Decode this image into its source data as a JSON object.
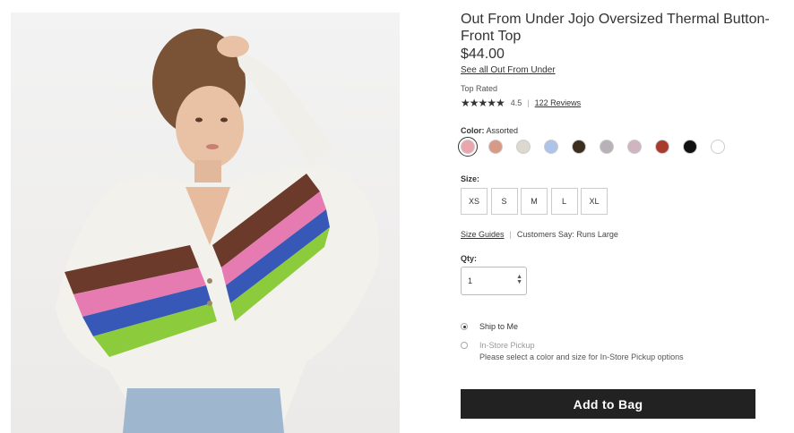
{
  "product": {
    "title": "Out From Under Jojo Oversized Thermal Button-Front Top",
    "price": "$44.00",
    "brand_link": "See all Out From Under",
    "badge": "Top Rated",
    "stars": "★★★★★",
    "rating": "4.5",
    "reviews": "122 Reviews"
  },
  "color": {
    "label": "Color:",
    "selected": "Assorted",
    "swatches": [
      {
        "name": "assorted",
        "color": "#e9a7ad"
      },
      {
        "name": "peach",
        "color": "#d89a86"
      },
      {
        "name": "cream",
        "color": "#dcd8cf"
      },
      {
        "name": "light-blue",
        "color": "#aec3e8"
      },
      {
        "name": "black-stripe",
        "color": "#3c2d1e"
      },
      {
        "name": "grey",
        "color": "#b8b2b8"
      },
      {
        "name": "mauve",
        "color": "#cfb5bf"
      },
      {
        "name": "rust",
        "color": "#a93a2e"
      },
      {
        "name": "black",
        "color": "#111111"
      },
      {
        "name": "white",
        "color": "#ffffff"
      }
    ]
  },
  "size": {
    "label": "Size:",
    "options": [
      "XS",
      "S",
      "M",
      "L",
      "XL"
    ]
  },
  "guides": {
    "link": "Size Guides",
    "customers_say": "Customers Say: Runs Large"
  },
  "qty": {
    "label": "Qty:",
    "value": "1"
  },
  "shipping": {
    "ship_label": "Ship to Me",
    "pickup_label": "In-Store Pickup",
    "pickup_note": "Please select a color and size for In-Store Pickup options"
  },
  "cta": {
    "add_to_bag": "Add to Bag"
  }
}
